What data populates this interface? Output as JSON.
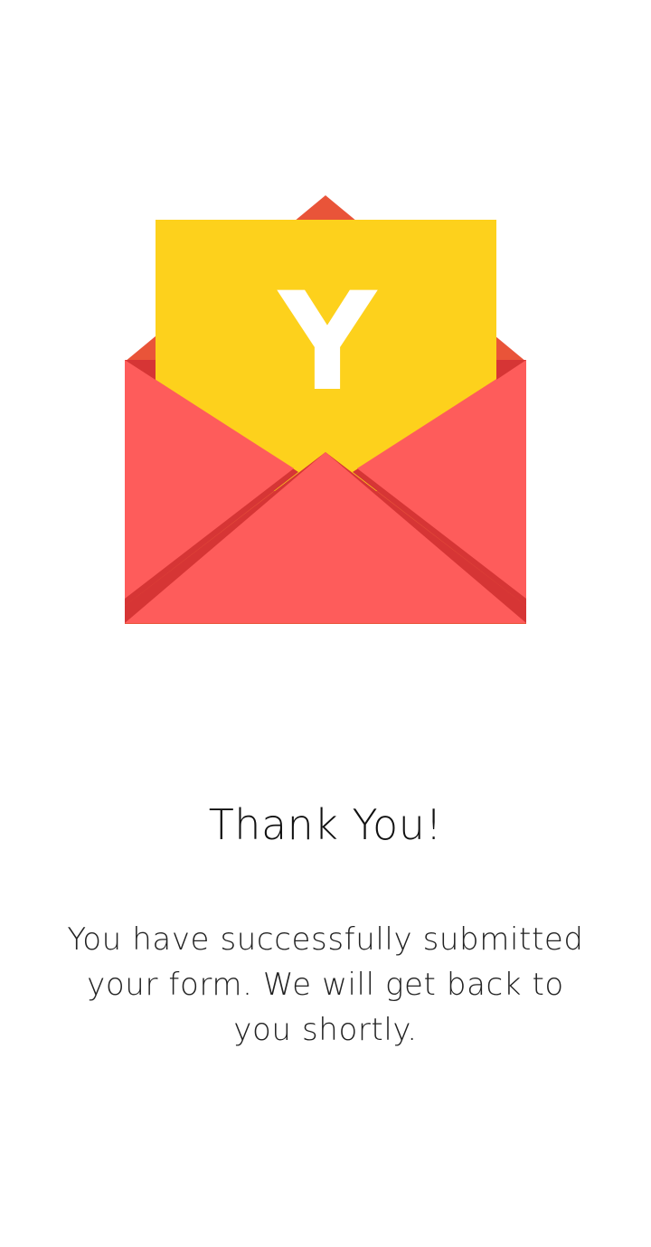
{
  "illustration": {
    "icon": "envelope-icon",
    "letter_glyph": "Y",
    "colors": {
      "envelope": "#fe5c5b",
      "envelope_dark": "#d63535",
      "flap_back": "#e95439",
      "letter": "#fdd11c",
      "letter_text": "#ffffff"
    }
  },
  "title": "Thank You!",
  "message": "You have successfully submitted your form. We will get back to you shortly."
}
